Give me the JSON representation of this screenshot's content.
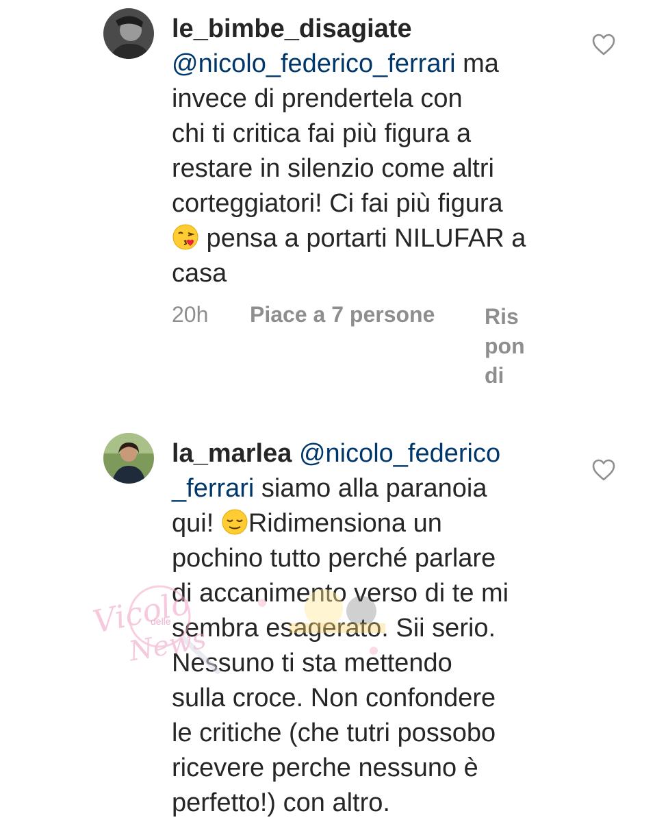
{
  "comments": [
    {
      "username": "le_bimbe_disagiate",
      "mention": "@nicolo_federico_ferrari",
      "lines": [
        " ma",
        "invece di prendertela con",
        "chi ti critica fai più figura a",
        "restare in silenzio come altri",
        "corteggiatori! Ci fai più figura",
        " pensa a portarti NILUFAR a",
        "casa"
      ],
      "emoji": "face-blowing-kiss",
      "time": "20h",
      "likes": "Piace a 7 persone",
      "reply_lines": [
        "Ris",
        "pon",
        "di"
      ]
    },
    {
      "username": "la_marlea",
      "mention_part1": "@nicolo_federico",
      "mention_part2": "_ferrari",
      "lines": [
        " siamo alla paranoia",
        "qui! ",
        "Ridimensiona un",
        "pochino tutto perché parlare",
        "di accanimento verso di te mi",
        "sembra esagerato. Sii serio.",
        "Nessuno ti sta mettendo",
        "sulla croce. Non confondere",
        "le critiche (che tutri possobo",
        "ricevere perche nessuno è",
        "perfetto!) con altro."
      ],
      "emoji": "relieved-face"
    }
  ],
  "watermark": {
    "text_main": "Vicolo",
    "text_small": "delle",
    "text_news": "News"
  },
  "colors": {
    "mention": "#00376b",
    "text": "#262626",
    "meta": "#8e8e8e"
  }
}
